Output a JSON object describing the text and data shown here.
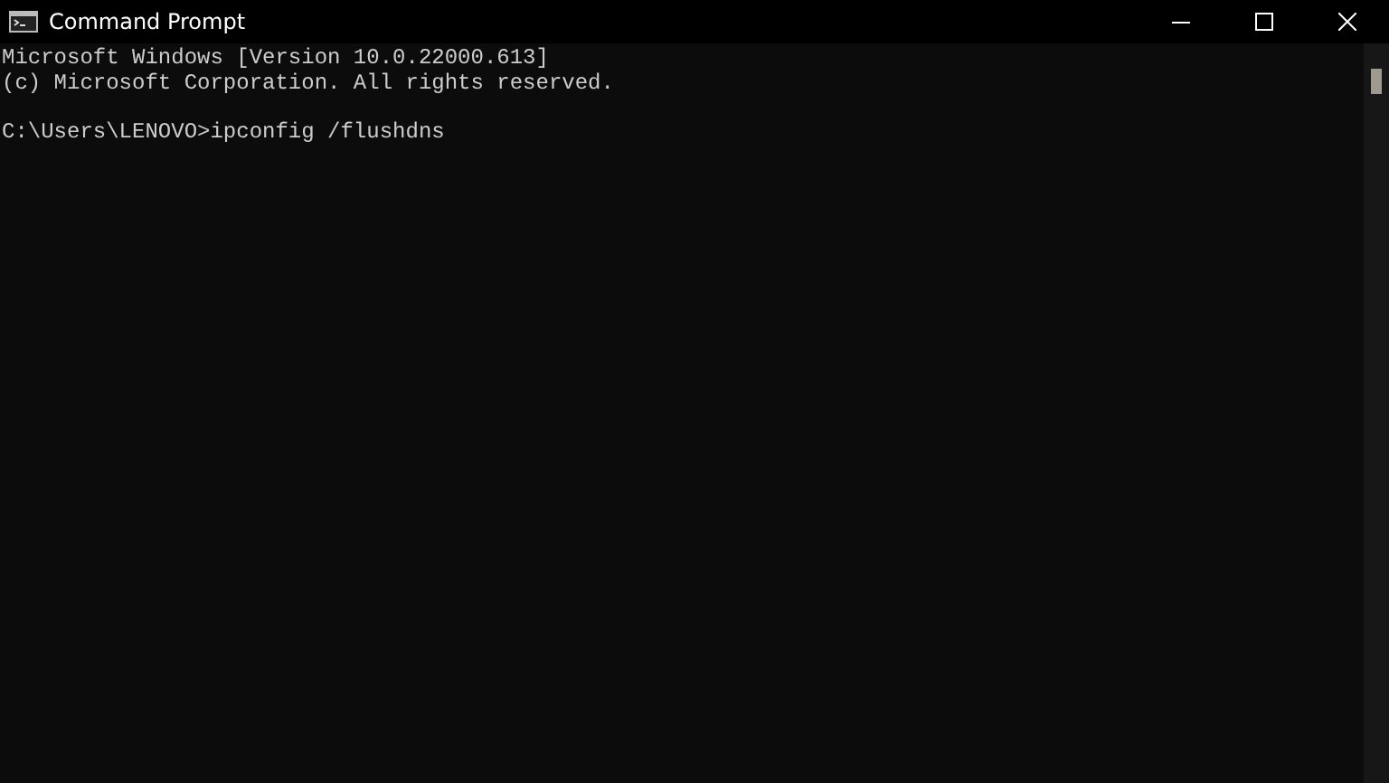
{
  "window": {
    "title": "Command Prompt"
  },
  "console": {
    "header": [
      "Microsoft Windows [Version 10.0.22000.613]",
      "(c) Microsoft Corporation. All rights reserved."
    ],
    "command_line": "C:\\Users\\LENOVO>ipconfig /flushdns"
  }
}
